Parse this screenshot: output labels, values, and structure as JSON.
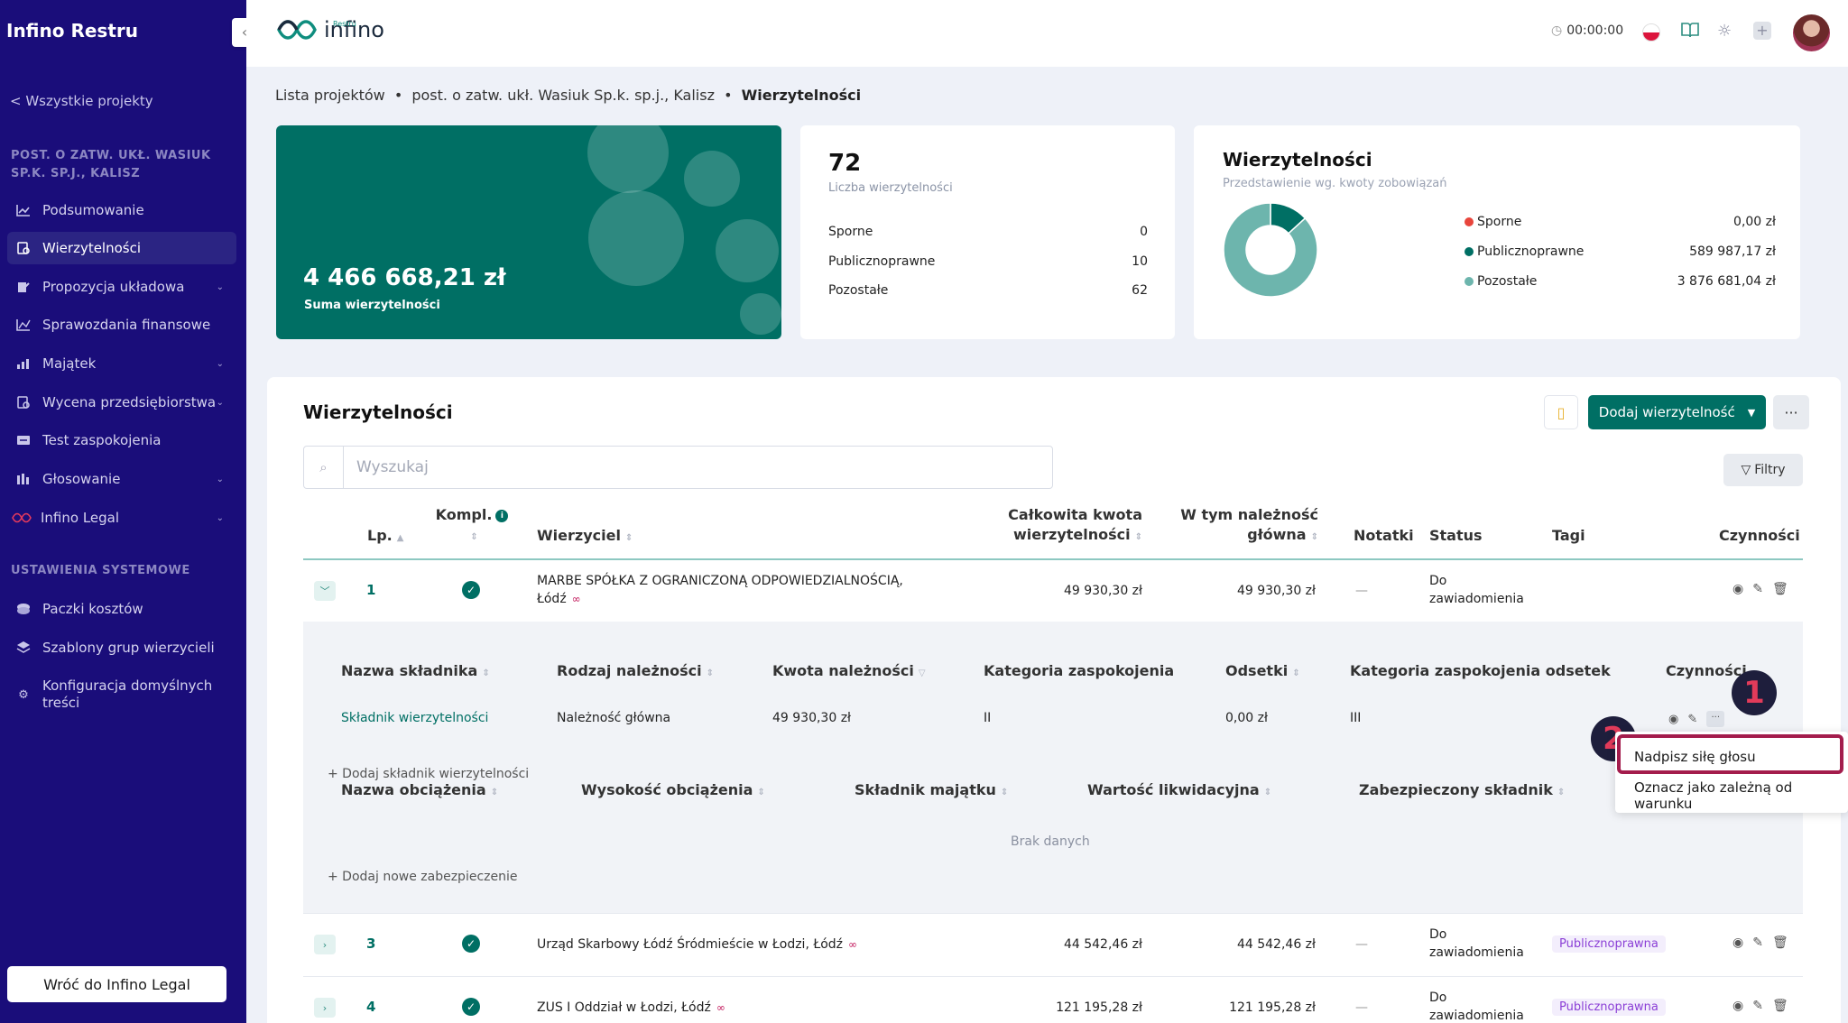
{
  "sidebar": {
    "app_title": "Infino Restru",
    "back_link": "< Wszystkie projekty",
    "project_name": "POST. O ZATW. UKŁ. WASIUK SP.K. SP.J., KALISZ",
    "items": [
      {
        "label": "Podsumowanie",
        "icon": "chart-line-icon"
      },
      {
        "label": "Wierzytelności",
        "icon": "claims-icon"
      },
      {
        "label": "Propozycja układowa",
        "icon": "proposal-icon"
      },
      {
        "label": "Sprawozdania finansowe",
        "icon": "report-icon"
      },
      {
        "label": "Majątek",
        "icon": "assets-icon"
      },
      {
        "label": "Wycena przedsiębiorstwa",
        "icon": "valuation-icon"
      },
      {
        "label": "Test zaspokojenia",
        "icon": "test-icon"
      },
      {
        "label": "Głosowanie",
        "icon": "voting-icon"
      },
      {
        "label": "Infino Legal",
        "icon": "infino-legal-icon"
      }
    ],
    "system_section": "USTAWIENIA SYSTEMOWE",
    "system_items": [
      {
        "label": "Paczki kosztów",
        "icon": "cost-packs-icon"
      },
      {
        "label": "Szablony grup wierzycieli",
        "icon": "layers-icon"
      },
      {
        "label": "Konfiguracja domyślnych treści",
        "icon": "gear-icon"
      }
    ],
    "footer_button": "Wróć do Infino Legal"
  },
  "header": {
    "logo_text": "infino",
    "logo_sub": "Restru",
    "timer": "00:00:00"
  },
  "breadcrumb": {
    "item1": "Lista projektów",
    "sep": "•",
    "item2": "post. o zatw. ukł. Wasiuk Sp.k. sp.j., Kalisz",
    "item3": "Wierzytelności"
  },
  "summary": {
    "total_value": "4 466 668,21 zł",
    "total_label": "Suma wierzytelności",
    "count": "72",
    "count_label": "Liczba wierzytelności",
    "rows": [
      {
        "label": "Sporne",
        "value": "0"
      },
      {
        "label": "Publicznoprawne",
        "value": "10"
      },
      {
        "label": "Pozostałe",
        "value": "62"
      }
    ]
  },
  "chart_card": {
    "title": "Wierzytelności",
    "subtitle": "Przedstawienie wg. kwoty zobowiązań"
  },
  "chart_data": {
    "type": "pie",
    "categories": [
      "Sporne",
      "Publicznoprawne",
      "Pozostałe"
    ],
    "values": [
      0.0,
      589987.17,
      3876681.04
    ],
    "value_labels": [
      "0,00 zł",
      "589 987,17 zł",
      "3 876 681,04 zł"
    ],
    "colors": [
      "#e8453c",
      "#006f64",
      "#6db5ad"
    ],
    "legend": "right"
  },
  "panel": {
    "title": "Wierzytelności",
    "add_button": "Dodaj wierzytelność",
    "more_button": "···",
    "search_placeholder": "Wyszukaj",
    "filter_button": "Filtry",
    "columns": {
      "lp": "Lp.",
      "kompl": "Kompl.",
      "creditor": "Wierzyciel",
      "total_1": "Całkowita kwota",
      "total_2": "wierzytelności",
      "main_1": "W tym należność",
      "main_2": "główna",
      "notes": "Notatki",
      "status": "Status",
      "tags": "Tagi",
      "actions": "Czynności"
    },
    "rows": [
      {
        "lp": "1",
        "creditor_1": "MARBE SPÓŁKA Z OGRANICZONĄ ODPOWIEDZIALNOŚCIĄ,",
        "creditor_2": "Łódź",
        "total": "49 930,30 zł",
        "main": "49 930,30 zł",
        "notes": "—",
        "status_1": "Do",
        "status_2": "zawiadomienia",
        "tag": ""
      },
      {
        "lp": "3",
        "creditor_1": "Urząd Skarbowy Łódź Śródmieście w Łodzi, Łódź",
        "total": "44 542,46 zł",
        "main": "44 542,46 zł",
        "notes": "—",
        "status_1": "Do",
        "status_2": "zawiadomienia",
        "tag": "Publicznoprawna"
      },
      {
        "lp": "4",
        "creditor_1": "ZUS I Oddział w Łodzi, Łódź",
        "total": "121 195,28 zł",
        "main": "121 195,28 zł",
        "notes": "—",
        "status_1": "Do",
        "status_2": "zawiadomienia",
        "tag": "Publicznoprawna"
      }
    ],
    "sub": {
      "columns": {
        "name": "Nazwa składnika",
        "type": "Rodzaj należności",
        "amount": "Kwota należności",
        "category": "Kategoria zaspokojenia",
        "interest": "Odsetki",
        "interest_category": "Kategoria zaspokojenia odsetek",
        "actions": "Czynności"
      },
      "row": {
        "name": "Składnik wierzytelności",
        "type": "Należność główna",
        "amount": "49 930,30 zł",
        "category": "II",
        "interest": "0,00 zł",
        "interest_category": "III"
      },
      "add_component": "+ Dodaj składnik wierzytelności",
      "encumbrance_columns": {
        "name": "Nazwa obciążenia",
        "height": "Wysokość obciążenia",
        "asset": "Składnik majątku",
        "liquidation": "Wartość likwidacyjna",
        "secured": "Zabezpieczony składnik"
      },
      "no_data": "Brak danych",
      "add_security": "+ Dodaj nowe zabezpieczenie"
    }
  },
  "dropdown": {
    "item1": "Nadpisz siłę głosu",
    "item2": "Oznacz jako zależną od warunku"
  },
  "annotations": {
    "badge1": "1",
    "badge2": "2"
  }
}
